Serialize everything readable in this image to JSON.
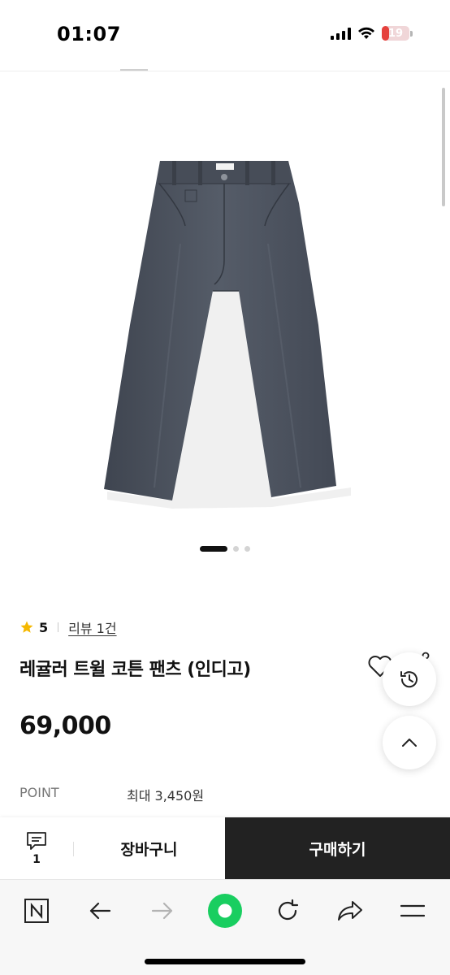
{
  "status_bar": {
    "time": "01:07",
    "battery": "19",
    "battery_level": 0.19
  },
  "gallery": {
    "total_images": 3,
    "active_index": 0
  },
  "product": {
    "rating": "5",
    "review_link": "리뷰 1건",
    "title": "레귤러 트윌 코튼 팬츠 (인디고)",
    "price": "69,000",
    "point_label": "POINT",
    "point_value": "최대 3,450원"
  },
  "purchase_bar": {
    "inquiry_count": "1",
    "cart_label": "장바구니",
    "buy_label": "구매하기"
  },
  "browser_toolbar": {
    "items": [
      "naver-home",
      "back",
      "forward",
      "green-dot",
      "reload",
      "share",
      "menu"
    ],
    "accent_color": "#19ce60"
  },
  "colors": {
    "buy_button": "#222222",
    "rating_star": "#f5b800",
    "pants": "#4b515c"
  }
}
